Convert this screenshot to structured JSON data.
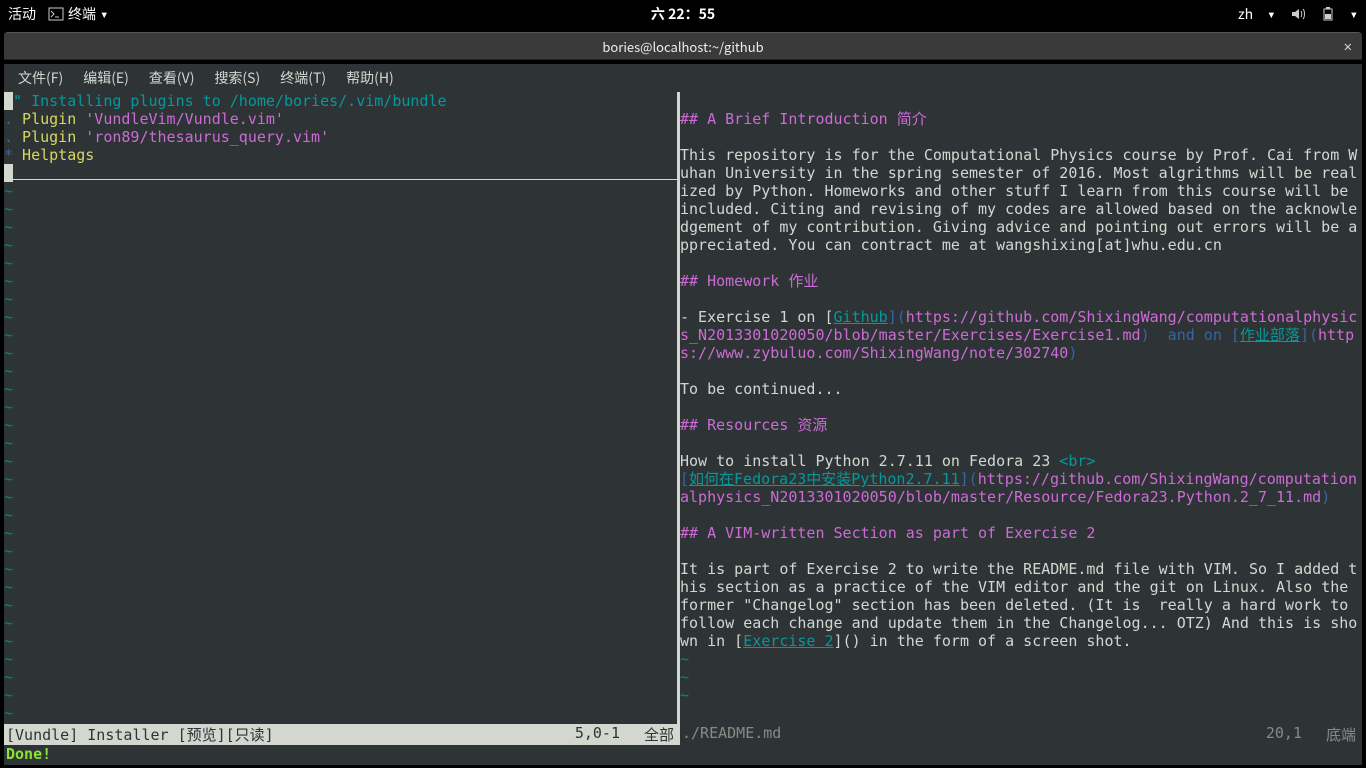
{
  "topbar": {
    "activities": "活动",
    "app_name": "终端",
    "clock": "六 22：55",
    "lang": "zh"
  },
  "window": {
    "title": "bories@localhost:~/github"
  },
  "menu": {
    "file": "文件(F)",
    "edit": "编辑(E)",
    "view": "查看(V)",
    "search": "搜索(S)",
    "terminal": "终端(T)",
    "help": "帮助(H)"
  },
  "left_pane": {
    "l1_comment": "\" Installing plugins to /home/bories/.vim/bundle",
    "l2_dot": ".",
    "l2_plugin": " Plugin ",
    "l2_name": "'VundleVim/Vundle.vim'",
    "l3_dot": ".",
    "l3_plugin": " Plugin ",
    "l3_name": "'ron89/thesaurus_query.vim'",
    "l4_star": "*",
    "l4_help": " Helptags",
    "l5_cursor": " "
  },
  "right_pane": {
    "h1": "## A Brief Introduction 简介",
    "p1": "This repository is for the Computational Physics course by Prof. Cai from Wuhan University in the spring semester of 2016. Most algrithms will be realized by Python. Homeworks and other stuff I learn from this course will be included. Citing and revising of my codes are allowed based on the acknowledgement of my contribution. Giving advice and pointing out errors will be appreciated. You can contract me at wangshixing[at]whu.edu.cn",
    "h2": "## Homework 作业",
    "ex1_pre": "- Exercise 1 on [",
    "ex1_link1": "Github",
    "ex1_mid1": "](",
    "ex1_url1": "https://github.com/ShixingWang/computationalphysics_N2013301020050/blob/master/Exercises/Exercise1.md",
    "ex1_mid2": ")  and on [",
    "ex1_link2": "作业部落",
    "ex1_mid3": "](",
    "ex1_url2": "https://www.zybuluo.com/ShixingWang/note/302740",
    "ex1_end": ")",
    "tbc": "To be continued...",
    "h3": "## Resources 资源",
    "res1a": "How to install Python 2.7.11 on Fedora 23 ",
    "res1b": "<br>",
    "res2_pre": "[",
    "res2_link": "如何在Fedora23中安装Python2.7.11",
    "res2_mid": "](",
    "res2_url": "https://github.com/ShixingWang/computationalphysics_N2013301020050/blob/master/Resource/Fedora23.Python.2_7_11.md",
    "res2_end": ")",
    "h4": "## A VIM-written Section as part of Exercise 2",
    "p2a": "It is part of Exercise 2 to write the README.md file with VIM. So I added this section as a practice of the VIM editor and the git on Linux. Also the former \"Changelog\" section has been deleted. (It is  really a hard work to follow each change and update them in the Changelog... OTZ) And this is shown in [",
    "p2_link": "Exercise 2",
    "p2b": "]() in the form of a screen shot."
  },
  "status_left": {
    "name": "[Vundle] Installer [预览][只读]",
    "pos": "5,0-1",
    "pct": "全部"
  },
  "status_right": {
    "name": "./README.md",
    "pos": "20,1",
    "pct": "底端"
  },
  "cmdline": {
    "msg": "Done!"
  }
}
